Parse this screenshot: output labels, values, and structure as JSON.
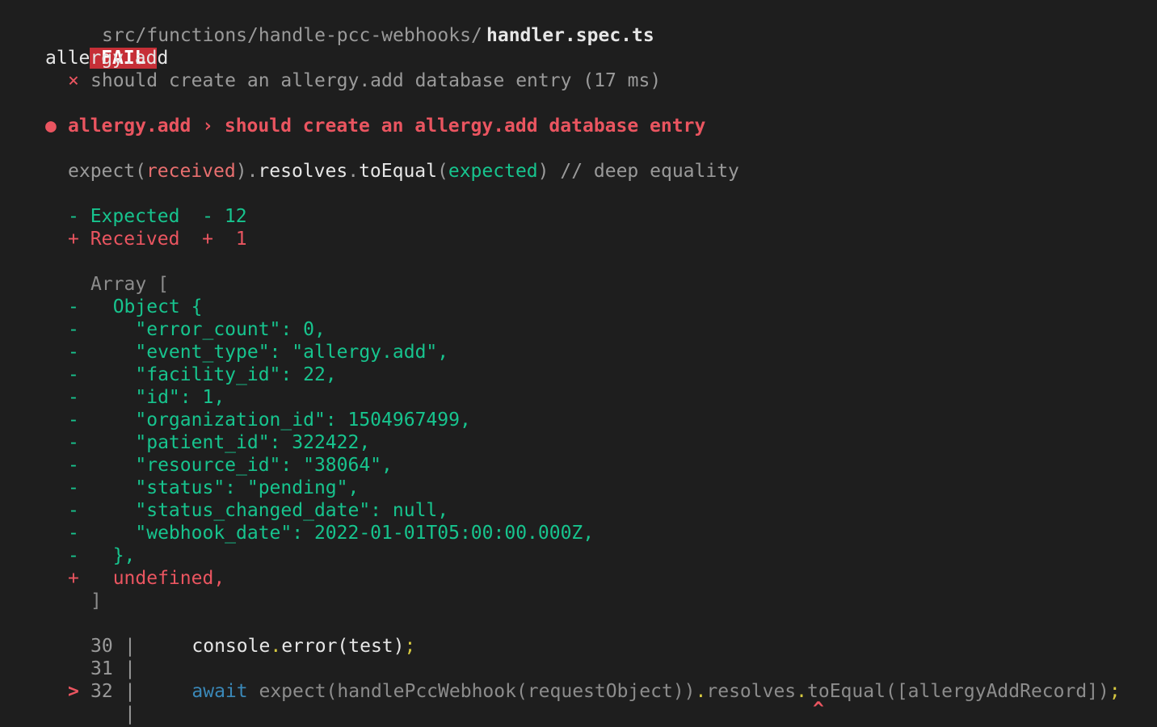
{
  "header": {
    "fail_badge": "FAIL",
    "path_dir": "src/functions/handle-pcc-webhooks/",
    "path_file": "handler.spec.ts"
  },
  "suite": {
    "name": "allergy.add",
    "test_mark": "×",
    "test_name": "should create an allergy.add database entry (17 ms)"
  },
  "error": {
    "bullet": "●",
    "title": "allergy.add › should create an allergy.add database entry"
  },
  "matcher": {
    "expect": "expect(",
    "received": "received",
    "close_dot": ").",
    "resolves": "resolves",
    "dot": ".",
    "to_equal": "toEqual",
    "open": "(",
    "expected": "expected",
    "close": ")",
    "comment": " // deep equality"
  },
  "diff_summary": {
    "expected_line": "- Expected  - 12",
    "received_line": "+ Received  +  1"
  },
  "diff": {
    "array_open": "Array [",
    "array_close": "]",
    "minus_lines": [
      "  Object {",
      "    \"error_count\": 0,",
      "    \"event_type\": \"allergy.add\",",
      "    \"facility_id\": 22,",
      "    \"id\": 1,",
      "    \"organization_id\": 1504967499,",
      "    \"patient_id\": 322422,",
      "    \"resource_id\": \"38064\",",
      "    \"status\": \"pending\",",
      "    \"status_changed_date\": null,",
      "    \"webhook_date\": 2022-01-01T05:00:00.000Z,",
      "  },"
    ],
    "plus_line": "  undefined,",
    "minus_sign": "-",
    "plus_sign": "+"
  },
  "code": {
    "line30_no": "30",
    "line30_code": "    console",
    "line30_dot": ".",
    "line30_rest": "error(test)",
    "line30_semi": ";",
    "line31_no": "31",
    "line32_marker": ">",
    "line32_no": "32",
    "line32_await": "    await",
    "line32_a": " expect(handlePccWebhook(requestObject))",
    "line32_dot1": ".",
    "line32_resolves": "resolves",
    "line32_dot2": ".",
    "line32_b": "toEqual([allergyAddRecord])",
    "line32_semi": ";",
    "gutter": "|",
    "caret": "^"
  },
  "colors": {
    "background": "#1e1e1e",
    "fail_badge": "#c62f37",
    "diff_expected": "#17c48e",
    "diff_received": "#ea5560"
  }
}
